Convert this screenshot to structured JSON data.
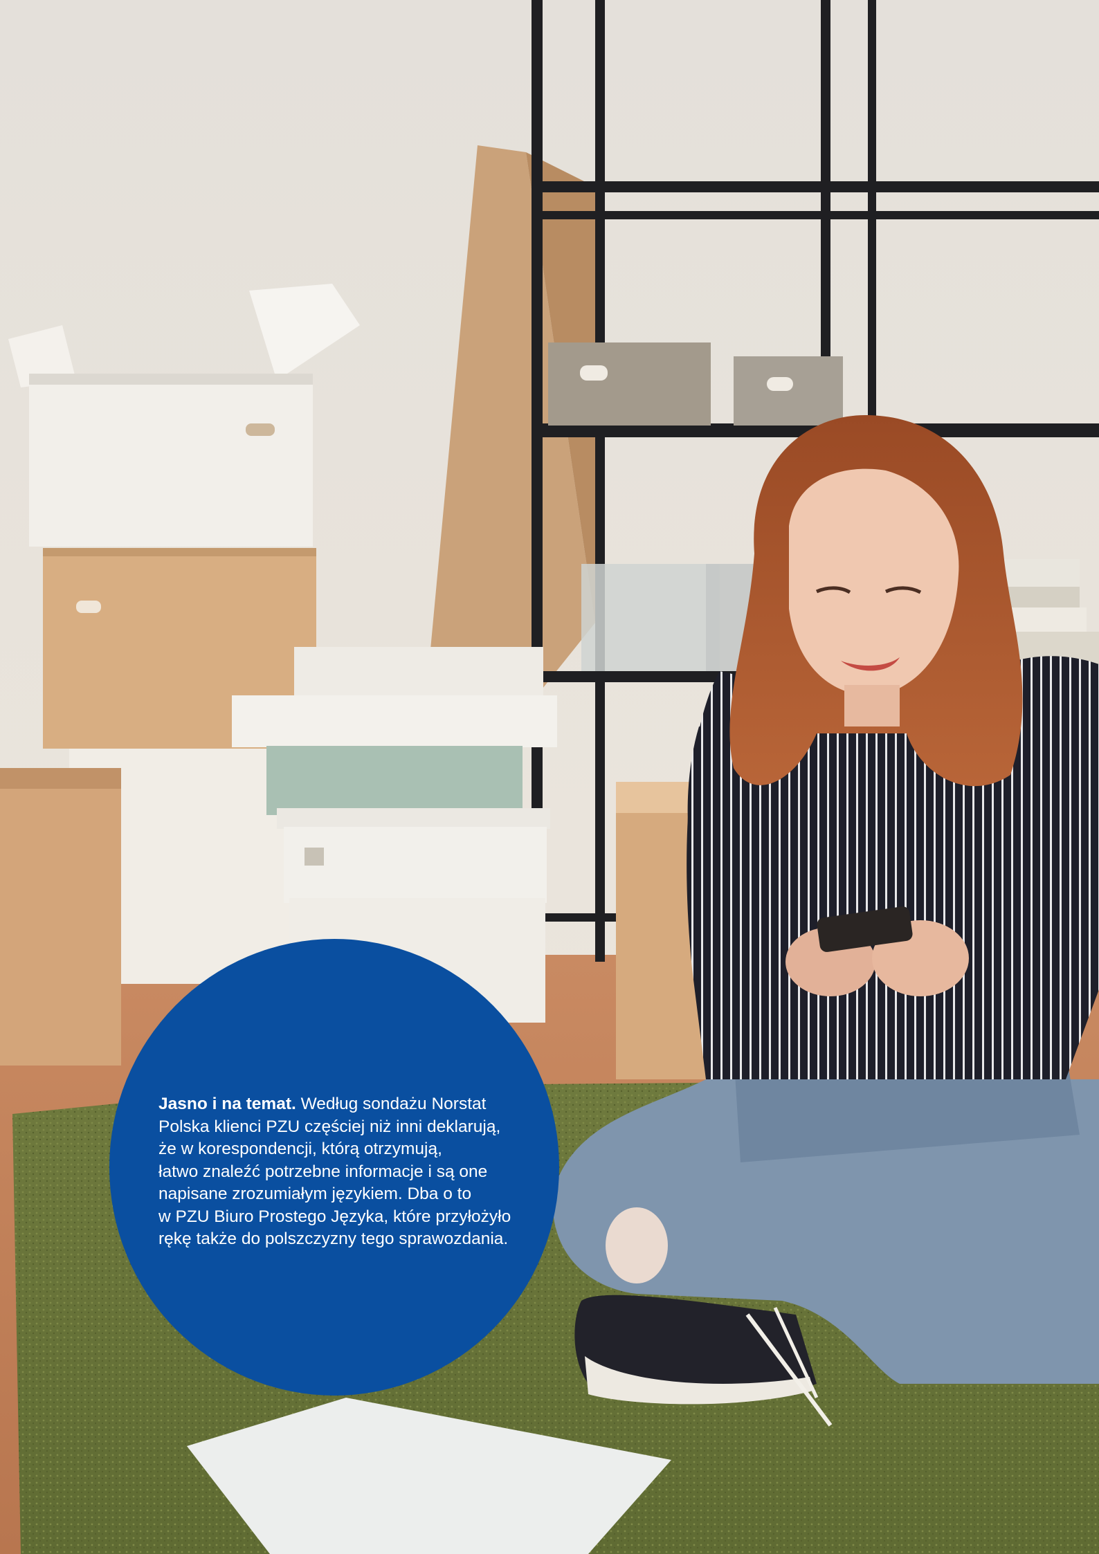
{
  "caption": {
    "lead": "Jasno i na temat.",
    "lines": [
      " Według sondażu Norstat",
      "Polska klienci PZU częściej niż inni deklarują,",
      "że w korespondencji, którą otrzymują,",
      "łatwo znaleźć potrzebne informacje i są one",
      "napisane zrozumiałym językiem. Dba o to",
      "w PZU Biuro Prostego Języka, które przyłożyło",
      "rękę także do polszczyzny tego sprawozdania."
    ]
  },
  "colors": {
    "circle": "#0a4fa0",
    "caption_text": "#ffffff"
  }
}
